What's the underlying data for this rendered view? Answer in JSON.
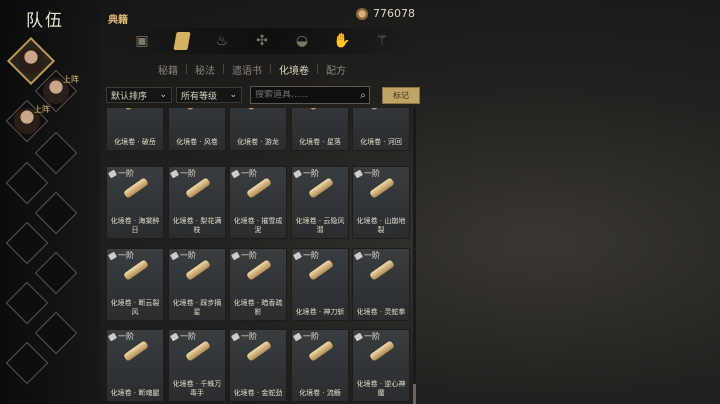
{
  "page_title": "队伍",
  "section_title": "典籍",
  "currency": {
    "icon": "coin-icon",
    "value": "776078"
  },
  "category_tabs": [
    {
      "icon": "chest-icon",
      "active": false
    },
    {
      "icon": "scroll-icon",
      "active": true
    },
    {
      "icon": "flame-icon",
      "active": false
    },
    {
      "icon": "herb-icon",
      "active": false
    },
    {
      "icon": "mask-icon",
      "active": false
    },
    {
      "icon": "hand-icon",
      "active": false
    },
    {
      "icon": "figure-icon",
      "active": false
    }
  ],
  "sub_tabs": [
    "秘籍",
    "秘法",
    "遗语书",
    "化境卷",
    "配方"
  ],
  "active_sub_tab": 3,
  "filters": {
    "sort": "默认排序",
    "grade": "所有等级",
    "search_placeholder": "搜索道具......",
    "mark_button": "标记"
  },
  "party_tags": [
    "上阵",
    "上阵"
  ],
  "items": [
    {
      "tier": "",
      "name": "化境卷 · 破岳"
    },
    {
      "tier": "",
      "name": "化境卷 · 风卷"
    },
    {
      "tier": "",
      "name": "化境卷 · 游龙"
    },
    {
      "tier": "",
      "name": "化境卷 · 星落"
    },
    {
      "tier": "",
      "name": "化境卷 · 河回"
    },
    {
      "tier": "一阶",
      "name": "化境卷 · 海棠醉日"
    },
    {
      "tier": "一阶",
      "name": "化境卷 · 梨花满枝"
    },
    {
      "tier": "一阶",
      "name": "化境卷 · 摧雪成泥"
    },
    {
      "tier": "一阶",
      "name": "化境卷 · 云隐风潜"
    },
    {
      "tier": "一阶",
      "name": "化境卷 · 山崩地裂"
    },
    {
      "tier": "一阶",
      "name": "化境卷 · 断云裂风"
    },
    {
      "tier": "一阶",
      "name": "化境卷 · 踩步摘星"
    },
    {
      "tier": "一阶",
      "name": "化境卷 · 暗香疏影"
    },
    {
      "tier": "一阶",
      "name": "化境卷 · 神刀斩"
    },
    {
      "tier": "一阶",
      "name": "化境卷 · 灵蛇拳"
    },
    {
      "tier": "一阶",
      "name": "化境卷 · 断魂腿"
    },
    {
      "tier": "一阶",
      "name": "化境卷 · 千蛛万毒手"
    },
    {
      "tier": "一阶",
      "name": "化境卷 · 金蛇劲"
    },
    {
      "tier": "一阶",
      "name": "化境卷 · 流觞"
    },
    {
      "tier": "一阶",
      "name": "化境卷 · 逆心神魔"
    }
  ]
}
